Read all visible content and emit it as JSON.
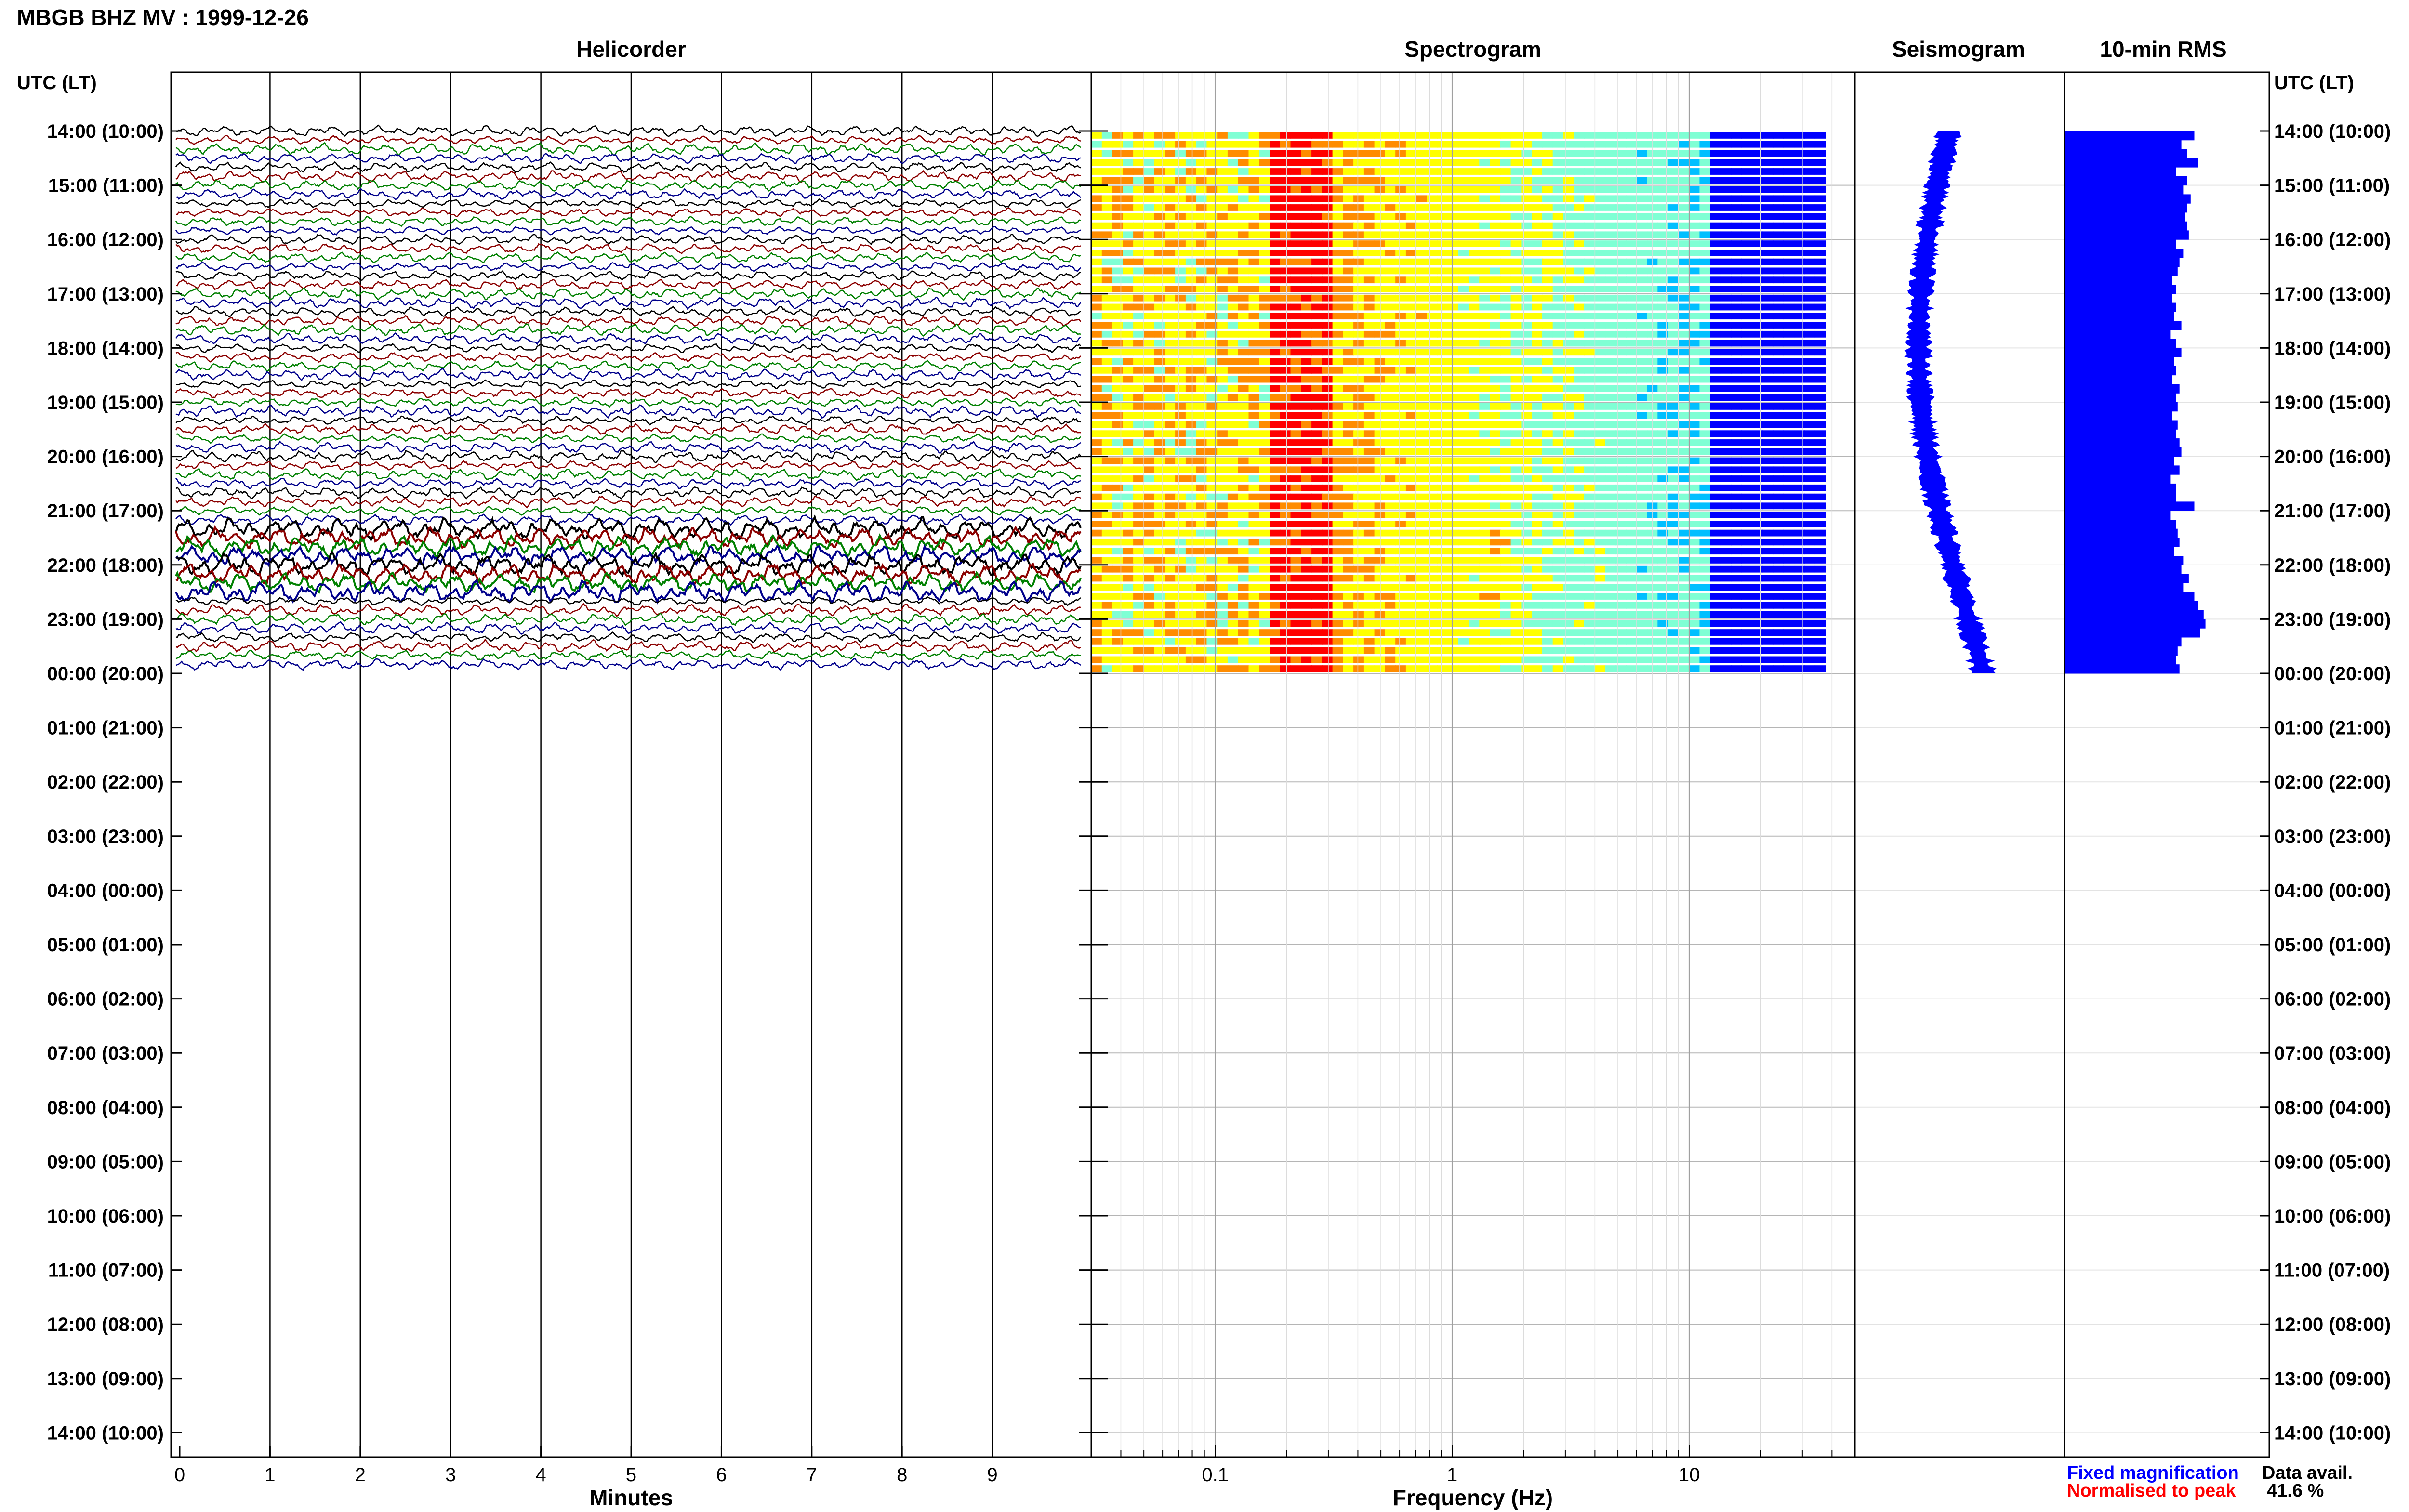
{
  "header": {
    "title": "MBGB BHZ MV : 1999-12-26",
    "panel_titles": [
      "Helicorder",
      "Spectrogram",
      "Seismogram",
      "10-min RMS"
    ],
    "left_axis_label": "UTC (LT)",
    "right_axis_label": "UTC (LT)"
  },
  "chart_data": [
    {
      "type": "line",
      "panel": "Helicorder",
      "title": "Helicorder",
      "xlabel": "Minutes",
      "xticks": [
        0,
        1,
        2,
        3,
        4,
        5,
        6,
        7,
        8,
        9
      ],
      "xlim": [
        0,
        10
      ],
      "row_colors": [
        "#000000",
        "#8b0000",
        "#008000",
        "#00008b"
      ],
      "rows_per_hour": 6,
      "data_start": "14:00",
      "data_end": "00:00",
      "high_amplitude_window": [
        "21:20",
        "22:30"
      ]
    },
    {
      "type": "heatmap",
      "panel": "Spectrogram",
      "title": "Spectrogram",
      "xlabel": "Frequency (Hz)",
      "xscale": "log",
      "xticks": [
        0.1,
        1,
        10
      ],
      "xlim": [
        0.03,
        50
      ],
      "data_max_freq": 37.5,
      "colormap": [
        "#00008b",
        "#0000ff",
        "#00bfff",
        "#7fffd4",
        "#ffff00",
        "#ff8c00",
        "#ff0000"
      ],
      "notable_features": [
        "strong band near 0.2 Hz",
        "narrow line near 1.5 Hz between 21:00 and 22:30"
      ]
    },
    {
      "type": "line",
      "panel": "Seismogram",
      "title": "Seismogram",
      "color": "#0000ff"
    },
    {
      "type": "bar",
      "panel": "10-min RMS",
      "title": "10-min RMS",
      "color": "#0000ff",
      "orientation": "horizontal",
      "interval_minutes": 10,
      "start": "14:00",
      "values": [
        0.7,
        0.63,
        0.66,
        0.72,
        0.6,
        0.66,
        0.64,
        0.68,
        0.66,
        0.65,
        0.66,
        0.67,
        0.6,
        0.64,
        0.62,
        0.61,
        0.58,
        0.6,
        0.58,
        0.6,
        0.59,
        0.63,
        0.57,
        0.6,
        0.63,
        0.59,
        0.6,
        0.58,
        0.62,
        0.6,
        0.61,
        0.58,
        0.61,
        0.6,
        0.62,
        0.63,
        0.59,
        0.62,
        0.57,
        0.6,
        0.6,
        0.7,
        0.57,
        0.6,
        0.61,
        0.62,
        0.59,
        0.64,
        0.63,
        0.67,
        0.64,
        0.7,
        0.72,
        0.75,
        0.76,
        0.73,
        0.63,
        0.61,
        0.6,
        0.62
      ]
    }
  ],
  "time_labels": [
    "14:00 (10:00)",
    "15:00 (11:00)",
    "16:00 (12:00)",
    "17:00 (13:00)",
    "18:00 (14:00)",
    "19:00 (15:00)",
    "20:00 (16:00)",
    "21:00 (17:00)",
    "22:00 (18:00)",
    "23:00 (19:00)",
    "00:00 (20:00)",
    "01:00 (21:00)",
    "02:00 (22:00)",
    "03:00 (23:00)",
    "04:00 (00:00)",
    "05:00 (01:00)",
    "06:00 (02:00)",
    "07:00 (03:00)",
    "08:00 (04:00)",
    "09:00 (05:00)",
    "10:00 (06:00)",
    "11:00 (07:00)",
    "12:00 (08:00)",
    "13:00 (09:00)",
    "14:00 (10:00)"
  ],
  "legend": {
    "fixed_label": "Fixed magnification",
    "fixed_color": "#0000ff",
    "normalised_label": "Normalised to peak",
    "normalised_color": "#ff0000"
  },
  "availability": {
    "label": "Data avail.",
    "value": "41.6 %"
  }
}
